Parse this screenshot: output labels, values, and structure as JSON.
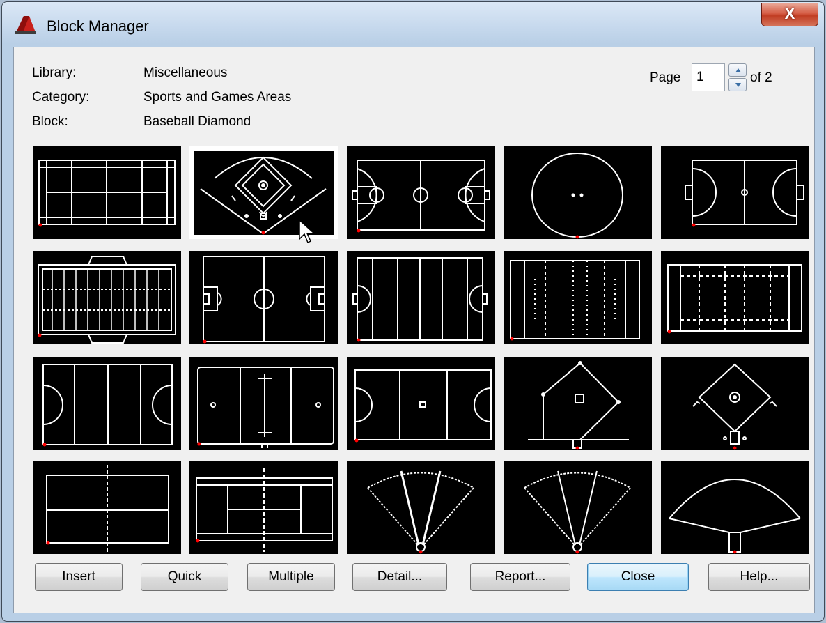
{
  "window": {
    "title": "Block Manager",
    "close_glyph": "X",
    "icon": "autocad-icon"
  },
  "info": {
    "library_label": "Library:",
    "library_value": "Miscellaneous",
    "category_label": "Category:",
    "category_value": "Sports and Games Areas",
    "block_label": "Block:",
    "block_value": "Baseball Diamond"
  },
  "pager": {
    "label": "Page",
    "value": "1",
    "of": "of 2"
  },
  "thumbnails": [
    {
      "row": 1,
      "col": 1,
      "icon": "court-lines-thumbnail"
    },
    {
      "row": 1,
      "col": 2,
      "icon": "baseball-field-thumbnail",
      "selected": true
    },
    {
      "row": 1,
      "col": 3,
      "icon": "basketball-court-thumbnail"
    },
    {
      "row": 1,
      "col": 4,
      "icon": "oval-field-thumbnail"
    },
    {
      "row": 1,
      "col": 5,
      "icon": "small-pitch-thumbnail"
    },
    {
      "row": 2,
      "col": 1,
      "icon": "football-field-thumbnail"
    },
    {
      "row": 2,
      "col": 2,
      "icon": "soccer-field-thumbnail"
    },
    {
      "row": 2,
      "col": 3,
      "icon": "hockey-field-thumbnail"
    },
    {
      "row": 2,
      "col": 4,
      "icon": "rugby-field-thumbnail"
    },
    {
      "row": 2,
      "col": 5,
      "icon": "dashed-field-thumbnail"
    },
    {
      "row": 3,
      "col": 1,
      "icon": "lacrosse-field-thumbnail"
    },
    {
      "row": 3,
      "col": 2,
      "icon": "ice-rink-thumbnail"
    },
    {
      "row": 3,
      "col": 3,
      "icon": "netball-court-thumbnail"
    },
    {
      "row": 3,
      "col": 4,
      "icon": "infield-diamond-thumbnail"
    },
    {
      "row": 3,
      "col": 5,
      "icon": "baseball-diamond-thumbnail"
    },
    {
      "row": 4,
      "col": 1,
      "icon": "volleyball-court-thumbnail"
    },
    {
      "row": 4,
      "col": 2,
      "icon": "tennis-court-thumbnail"
    },
    {
      "row": 4,
      "col": 3,
      "icon": "shot-put-sector-thumbnail"
    },
    {
      "row": 4,
      "col": 4,
      "icon": "discus-sector-thumbnail"
    },
    {
      "row": 4,
      "col": 5,
      "icon": "javelin-sector-thumbnail"
    }
  ],
  "buttons": {
    "insert": "Insert",
    "quick": "Quick",
    "multiple": "Multiple",
    "detail": "Detail...",
    "report": "Report...",
    "close": "Close",
    "help": "Help..."
  },
  "colors": {
    "thumbnail_bg": "#000000",
    "line": "#ffffff",
    "insertion_point": "#ff0000",
    "default_button": "#3c7fb1"
  }
}
